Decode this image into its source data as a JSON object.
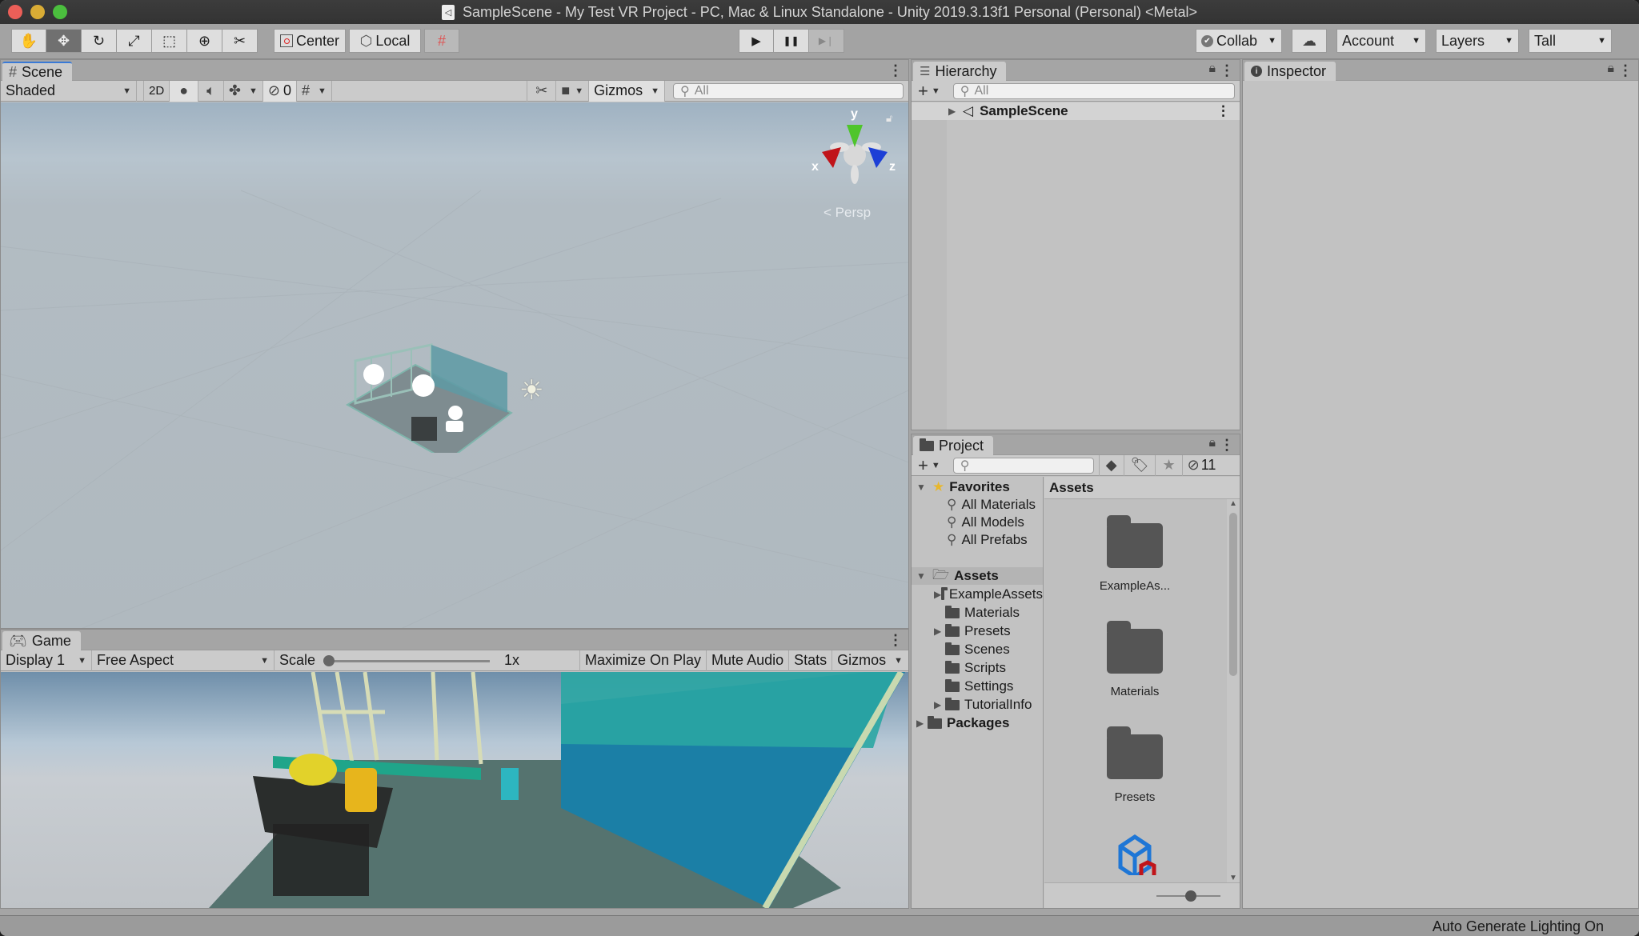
{
  "window": {
    "title": "SampleScene - My Test VR Project - PC, Mac & Linux Standalone - Unity 2019.3.13f1 Personal (Personal) <Metal>",
    "traffic_colors": {
      "close": "#ec5f58",
      "minimize": "#d9ac35",
      "maximize": "#4bbf3e"
    }
  },
  "toolbar": {
    "tools": [
      {
        "name": "hand-tool",
        "icon": "hand-icon",
        "glyph": "✋"
      },
      {
        "name": "move-tool",
        "icon": "move-icon",
        "glyph": "✥",
        "active": true
      },
      {
        "name": "rotate-tool",
        "icon": "rotate-icon",
        "glyph": "↻"
      },
      {
        "name": "scale-tool",
        "icon": "scale-icon",
        "glyph": "⤢"
      },
      {
        "name": "rect-tool",
        "icon": "rect-icon",
        "glyph": "⬚"
      },
      {
        "name": "transform-tool",
        "icon": "transform-icon",
        "glyph": "⊕"
      },
      {
        "name": "custom-tool",
        "icon": "tools-icon",
        "glyph": "✂"
      }
    ],
    "pivot_label": "Center",
    "space_label": "Local",
    "play": "▶",
    "pause": "❚❚",
    "step": "▶❘",
    "collab_label": "Collab",
    "account_label": "Account",
    "layers_label": "Layers",
    "layout_label": "Tall"
  },
  "scene": {
    "tab_label": "Scene",
    "shading_mode": "Shaded",
    "mode_2d": "2D",
    "hidden_count": "0",
    "gizmos_label": "Gizmos",
    "search_placeholder": "All",
    "axis_labels": {
      "x": "x",
      "y": "y",
      "z": "z"
    },
    "projection_label": "Persp"
  },
  "game": {
    "tab_label": "Game",
    "display": "Display 1",
    "aspect": "Free Aspect",
    "scale_label": "Scale",
    "scale_value": "1x",
    "scale_fraction": 0.0,
    "buttons": [
      "Maximize On Play",
      "Mute Audio",
      "Stats",
      "Gizmos"
    ]
  },
  "hierarchy": {
    "tab_label": "Hierarchy",
    "search_placeholder": "All",
    "items": [
      {
        "label": "SampleScene"
      }
    ]
  },
  "inspector": {
    "tab_label": "Inspector"
  },
  "project": {
    "tab_label": "Project",
    "search_placeholder": "",
    "hidden_packages_count": "11",
    "favorites": {
      "label": "Favorites",
      "items": [
        "All Materials",
        "All Models",
        "All Prefabs"
      ]
    },
    "assets_root": "Assets",
    "asset_folders": [
      {
        "label": "ExampleAssets",
        "expandable": true
      },
      {
        "label": "Materials",
        "expandable": false
      },
      {
        "label": "Presets",
        "expandable": true
      },
      {
        "label": "Scenes",
        "expandable": false
      },
      {
        "label": "Scripts",
        "expandable": false
      },
      {
        "label": "Settings",
        "expandable": false
      },
      {
        "label": "TutorialInfo",
        "expandable": true
      }
    ],
    "packages_label": "Packages",
    "breadcrumb": "Assets",
    "grid_items": [
      {
        "label": "ExampleAs...",
        "type": "folder"
      },
      {
        "label": "Materials",
        "type": "folder"
      },
      {
        "label": "Presets",
        "type": "folder"
      },
      {
        "label": "",
        "type": "package-icon"
      }
    ],
    "icon_size_fraction": 0.55
  },
  "status": {
    "message": "Auto Generate Lighting On"
  },
  "colors": {
    "accent": "#3a7ad6",
    "favorite_star": "#e8b72c",
    "axis_x": "#c0141a",
    "axis_y": "#4fc52b",
    "axis_z": "#1c3fd6"
  }
}
